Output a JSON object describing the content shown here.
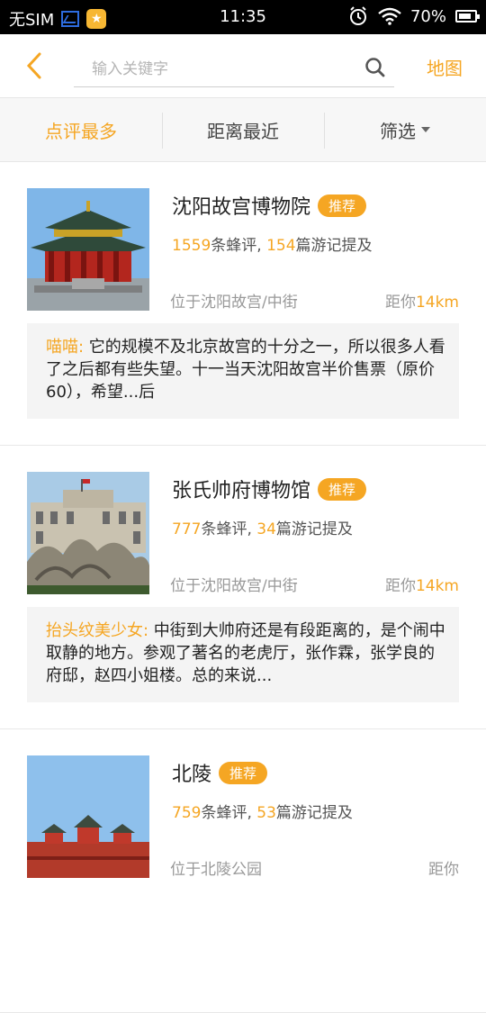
{
  "status_bar": {
    "carrier": "无SIM",
    "time": "11:35",
    "battery": "70%",
    "app_icon_glyph": "★"
  },
  "header": {
    "back_icon": "chevron-left-icon",
    "search_placeholder": "输入关键字",
    "search_value": "",
    "map_label": "地图"
  },
  "tabs": [
    {
      "label": "点评最多",
      "active": true
    },
    {
      "label": "距离最近",
      "active": false
    },
    {
      "label": "筛选",
      "active": false
    }
  ],
  "colors": {
    "accent": "#f5a623",
    "background": "#ffffff",
    "tab_bar": "#f7f7f7",
    "review_bg": "#f4f4f4"
  },
  "items": [
    {
      "name": "沈阳故宫博物院",
      "badge": "推荐",
      "reviews_count": "1559",
      "reviews_label": "条蜂评, ",
      "notes_count": "154",
      "notes_label": "篇游记提及",
      "location": "位于沈阳故宫/中街",
      "distance_prefix": "距你",
      "distance": "14km",
      "review_author": "喵喵:",
      "review_text": " 它的规模不及北京故宫的十分之一，所以很多人看了之后都有些失望。十一当天沈阳故宫半价售票（原价60），希望...后"
    },
    {
      "name": "张氏帅府博物馆",
      "badge": "推荐",
      "reviews_count": "777",
      "reviews_label": "条蜂评, ",
      "notes_count": "34",
      "notes_label": "篇游记提及",
      "location": "位于沈阳故宫/中街",
      "distance_prefix": "距你",
      "distance": "14km",
      "review_author": "抬头纹美少女:",
      "review_text": " 中街到大帅府还是有段距离的，是个闹中取静的地方。参观了著名的老虎厅，张作霖，张学良的府邸，赵四小姐楼。总的来说..."
    },
    {
      "name": "北陵",
      "badge": "推荐",
      "reviews_count": "759",
      "reviews_label": "条蜂评, ",
      "notes_count": "53",
      "notes_label": "篇游记提及",
      "location": "位于北陵公园",
      "distance_prefix": "距你",
      "distance": "",
      "review_author": "",
      "review_text": ""
    }
  ]
}
